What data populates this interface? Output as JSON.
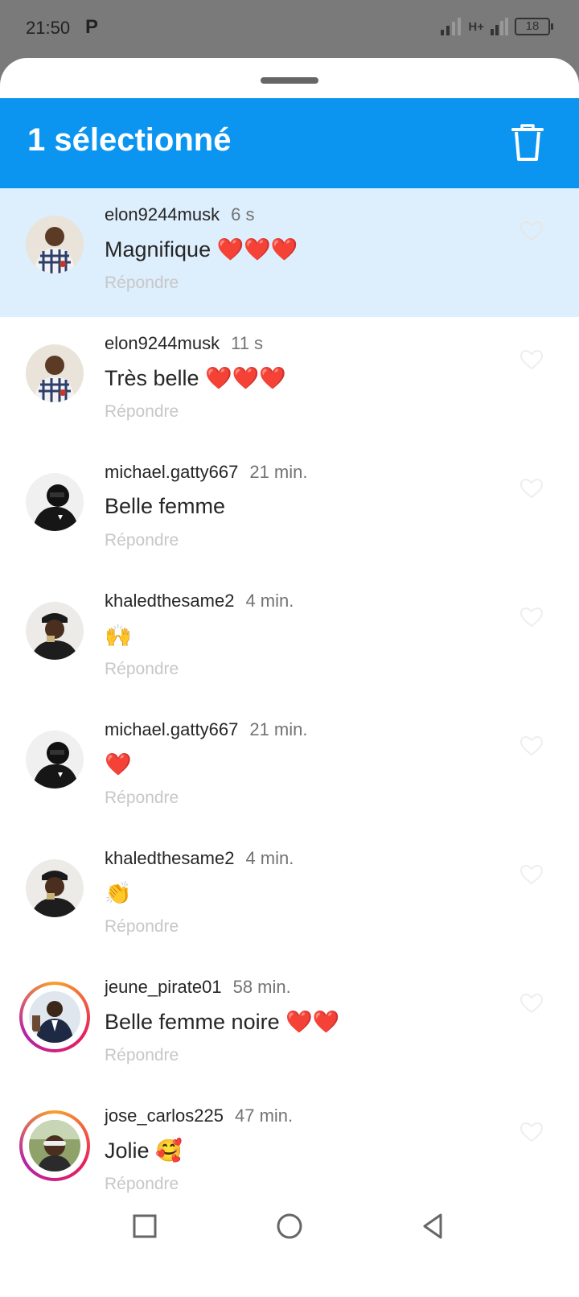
{
  "status_bar": {
    "time": "21:50",
    "carrier_icon": "P",
    "network": "H+",
    "battery": "18"
  },
  "header": {
    "title": "1 sélectionné",
    "delete_icon": "trash-icon",
    "background": "#0b95f1"
  },
  "comments": [
    {
      "username": "elon9244musk",
      "time": "6 s",
      "text": "Magnifique ❤️❤️❤️",
      "reply": "Répondre",
      "selected": true
    },
    {
      "username": "elon9244musk",
      "time": "11 s",
      "text": "Très belle ❤️❤️❤️",
      "reply": "Répondre"
    },
    {
      "username": "michael.gatty667",
      "time": "21 min.",
      "text": "Belle femme",
      "reply": "Répondre"
    },
    {
      "username": "khaledthesame2",
      "time": "4 min.",
      "text": "🙌",
      "reply": "Répondre"
    },
    {
      "username": "michael.gatty667",
      "time": "21 min.",
      "text": "❤️",
      "reply": "Répondre"
    },
    {
      "username": "khaledthesame2",
      "time": "4 min.",
      "text": "👏",
      "reply": "Répondre"
    },
    {
      "username": "jeune_pirate01",
      "time": "58 min.",
      "text": "Belle femme noire ❤️❤️",
      "reply": "Répondre",
      "story_ring": true
    },
    {
      "username": "jose_carlos225",
      "time": "47 min.",
      "text": "Jolie 🥰",
      "reply": "Répondre",
      "story_ring": true
    }
  ],
  "nav": {
    "recent_icon": "square-icon",
    "home_icon": "circle-icon",
    "back_icon": "triangle-back-icon"
  }
}
